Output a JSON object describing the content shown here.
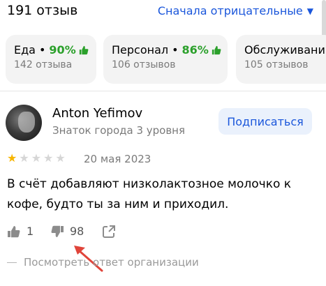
{
  "header": {
    "reviews_count": "191 отзыв",
    "sort_label": "Сначала отрицательные",
    "sort_caret": "▼"
  },
  "categories": [
    {
      "name": "Еда",
      "percent": "90%",
      "reviews": "142 отзыва"
    },
    {
      "name": "Персонал",
      "percent": "86%",
      "reviews": "106 отзывов"
    },
    {
      "name": "Обслуживани",
      "percent": "",
      "reviews": "105 отзывов"
    }
  ],
  "review": {
    "author": "Anton Yefimov",
    "level": "Знаток города 3 уровня",
    "subscribe_label": "Подписаться",
    "rating": 1,
    "rating_max": 5,
    "date": "20 мая 2023",
    "text": "В счёт добавляют низколактозное молочко к кофе, будто ты за ним и приходил.",
    "likes": "1",
    "dislikes": "98",
    "org_reply_label": "Посмотреть ответ организации"
  },
  "colors": {
    "accent": "#1a56db",
    "positive": "#2ba02b",
    "star_active": "#f7b500",
    "star_inactive": "#d6d6d6",
    "annotation_arrow": "#e0443a"
  },
  "icons": [
    "thumbs-up-icon",
    "thumbs-down-icon",
    "share-icon",
    "star-icon",
    "chevron-down-icon"
  ]
}
